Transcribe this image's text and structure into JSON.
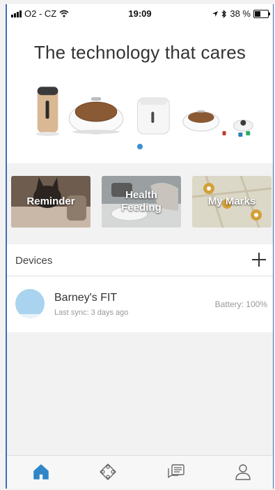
{
  "status_bar": {
    "carrier": "O2 - CZ",
    "time": "19:09",
    "battery_percent": "38 %"
  },
  "hero": {
    "title": "The technology that cares",
    "carousel_pages": 1,
    "active_page": 1
  },
  "features": [
    {
      "label": "Reminder"
    },
    {
      "label": "Health\nFeeding"
    },
    {
      "label": "My Marks"
    }
  ],
  "devices": {
    "header": "Devices",
    "items": [
      {
        "name": "Barney's FIT",
        "last_sync": "Last sync: 3 days ago",
        "battery": "Battery: 100%"
      }
    ]
  },
  "tabbar": {
    "active": "home",
    "items": [
      "home-icon",
      "devices-diamond-icon",
      "chat-icon",
      "profile-icon"
    ]
  },
  "colors": {
    "accent": "#3a8fd1",
    "active_tab": "#2f86c8",
    "inactive_tab": "#666666",
    "frame": "#3d6fb6"
  }
}
